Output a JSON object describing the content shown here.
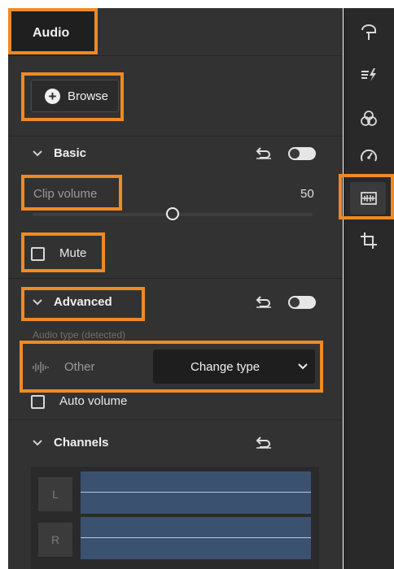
{
  "panel": {
    "title": "Audio",
    "browse_label": "Browse"
  },
  "basic": {
    "title": "Basic",
    "clip_volume_label": "Clip volume",
    "clip_volume_value": "50",
    "clip_volume_level": 0.5,
    "mute_label": "Mute",
    "mute_checked": false,
    "enabled": true
  },
  "advanced": {
    "title": "Advanced",
    "audio_type_label": "Audio type (detected)",
    "audio_type_value": "Other",
    "change_type_label": "Change type",
    "auto_volume_label": "Auto volume",
    "auto_volume_checked": false,
    "enabled": true
  },
  "channels": {
    "title": "Channels",
    "items": [
      {
        "label": "L"
      },
      {
        "label": "R"
      }
    ]
  },
  "toolbar": {
    "icons": [
      "titles-icon",
      "transitions-icon",
      "color-icon",
      "speed-icon",
      "audio-icon",
      "crop-icon"
    ],
    "active": "audio-icon"
  },
  "colors": {
    "panel_bg": "#323232",
    "toolbar_bg": "#292929",
    "highlight": "#f08a24",
    "waveform": "#3b5170"
  }
}
